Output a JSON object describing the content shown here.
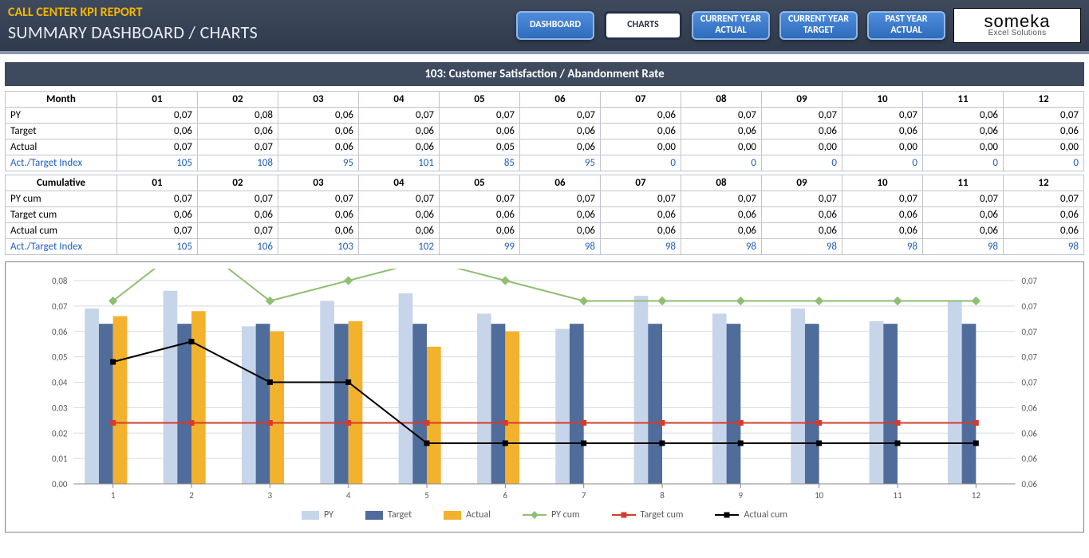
{
  "header": {
    "title": "CALL CENTER KPI REPORT",
    "subtitle": "SUMMARY DASHBOARD / CHARTS"
  },
  "nav": {
    "dashboard": "DASHBOARD",
    "charts": "CHARTS",
    "cy_actual": "CURRENT YEAR ACTUAL",
    "cy_target": "CURRENT YEAR TARGET",
    "py_actual": "PAST YEAR ACTUAL"
  },
  "logo": {
    "brand": "someka",
    "tag": "Excel Solutions"
  },
  "kpi_title": "103: Customer Satisfaction / Abandonment Rate",
  "months": [
    "01",
    "02",
    "03",
    "04",
    "05",
    "06",
    "07",
    "08",
    "09",
    "10",
    "11",
    "12"
  ],
  "monthly": {
    "label_head": "Month",
    "rows": {
      "py": {
        "label": "PY",
        "values": [
          "0,07",
          "0,08",
          "0,06",
          "0,07",
          "0,07",
          "0,07",
          "0,06",
          "0,07",
          "0,07",
          "0,07",
          "0,06",
          "0,07"
        ]
      },
      "target": {
        "label": "Target",
        "values": [
          "0,06",
          "0,06",
          "0,06",
          "0,06",
          "0,06",
          "0,06",
          "0,06",
          "0,06",
          "0,06",
          "0,06",
          "0,06",
          "0,06"
        ]
      },
      "actual": {
        "label": "Actual",
        "values": [
          "0,07",
          "0,07",
          "0,06",
          "0,06",
          "0,05",
          "0,06",
          "0,00",
          "0,00",
          "0,00",
          "0,00",
          "0,00",
          "0,00"
        ]
      },
      "index": {
        "label": "Act./Target Index",
        "values": [
          "105",
          "108",
          "95",
          "101",
          "85",
          "95",
          "0",
          "0",
          "0",
          "0",
          "0",
          "0"
        ]
      }
    }
  },
  "cumulative": {
    "label_head": "Cumulative",
    "rows": {
      "py": {
        "label": "PY cum",
        "values": [
          "0,07",
          "0,07",
          "0,07",
          "0,07",
          "0,07",
          "0,07",
          "0,07",
          "0,07",
          "0,07",
          "0,07",
          "0,07",
          "0,07"
        ]
      },
      "target": {
        "label": "Target cum",
        "values": [
          "0,06",
          "0,06",
          "0,06",
          "0,06",
          "0,06",
          "0,06",
          "0,06",
          "0,06",
          "0,06",
          "0,06",
          "0,06",
          "0,06"
        ]
      },
      "actual": {
        "label": "Actual cum",
        "values": [
          "0,07",
          "0,07",
          "0,06",
          "0,06",
          "0,06",
          "0,06",
          "0,06",
          "0,06",
          "0,06",
          "0,06",
          "0,06",
          "0,06"
        ]
      },
      "index": {
        "label": "Act./Target Index",
        "values": [
          "105",
          "106",
          "103",
          "102",
          "99",
          "98",
          "98",
          "98",
          "98",
          "98",
          "98",
          "98"
        ]
      }
    }
  },
  "legend": {
    "py": "PY",
    "target": "Target",
    "actual": "Actual",
    "pycum": "PY cum",
    "targetcum": "Target cum",
    "actualcum": "Actual cum"
  },
  "colors": {
    "py_bar": "#c7d5ea",
    "target_bar": "#4f6c9a",
    "actual_bar": "#f3b22e",
    "py_line": "#8fbf72",
    "target_line": "#d43b2e",
    "actual_line": "#000000",
    "grid": "#d6d9df",
    "axis": "#888"
  },
  "chart_data": {
    "type": "bar+line (dual-axis combo)",
    "title": "103: Customer Satisfaction / Abandonment Rate",
    "x": [
      1,
      2,
      3,
      4,
      5,
      6,
      7,
      8,
      9,
      10,
      11,
      12
    ],
    "left_axis": {
      "label": "",
      "ylim": [
        0,
        0.08
      ],
      "ticks": [
        "0,00",
        "0,01",
        "0,02",
        "0,03",
        "0,04",
        "0,05",
        "0,06",
        "0,07",
        "0,08"
      ],
      "series": [
        {
          "name": "PY",
          "kind": "bar",
          "color": "#c7d5ea",
          "values": [
            0.069,
            0.076,
            0.062,
            0.072,
            0.075,
            0.067,
            0.061,
            0.074,
            0.067,
            0.069,
            0.064,
            0.072
          ]
        },
        {
          "name": "Target",
          "kind": "bar",
          "color": "#4f6c9a",
          "values": [
            0.063,
            0.063,
            0.063,
            0.063,
            0.063,
            0.063,
            0.063,
            0.063,
            0.063,
            0.063,
            0.063,
            0.063
          ]
        },
        {
          "name": "Actual",
          "kind": "bar",
          "color": "#f3b22e",
          "values": [
            0.066,
            0.068,
            0.06,
            0.064,
            0.054,
            0.06,
            0,
            0,
            0,
            0,
            0,
            0
          ]
        }
      ]
    },
    "right_axis": {
      "label": "",
      "ylim": [
        0.06,
        0.07
      ],
      "ticks": [
        "0,06",
        "0,06",
        "0,06",
        "0,06",
        "0,07",
        "0,07",
        "0,07",
        "0,07",
        "0,07"
      ],
      "series": [
        {
          "name": "PY cum",
          "kind": "line",
          "color": "#8fbf72",
          "values": [
            0.069,
            0.072,
            0.069,
            0.07,
            0.071,
            0.07,
            0.069,
            0.069,
            0.069,
            0.069,
            0.069,
            0.069
          ]
        },
        {
          "name": "Target cum",
          "kind": "line",
          "color": "#d43b2e",
          "values": [
            0.063,
            0.063,
            0.063,
            0.063,
            0.063,
            0.063,
            0.063,
            0.063,
            0.063,
            0.063,
            0.063,
            0.063
          ]
        },
        {
          "name": "Actual cum",
          "kind": "line",
          "color": "#000000",
          "values": [
            0.066,
            0.067,
            0.065,
            0.065,
            0.062,
            0.062,
            0.062,
            0.062,
            0.062,
            0.062,
            0.062,
            0.062
          ]
        }
      ]
    }
  }
}
